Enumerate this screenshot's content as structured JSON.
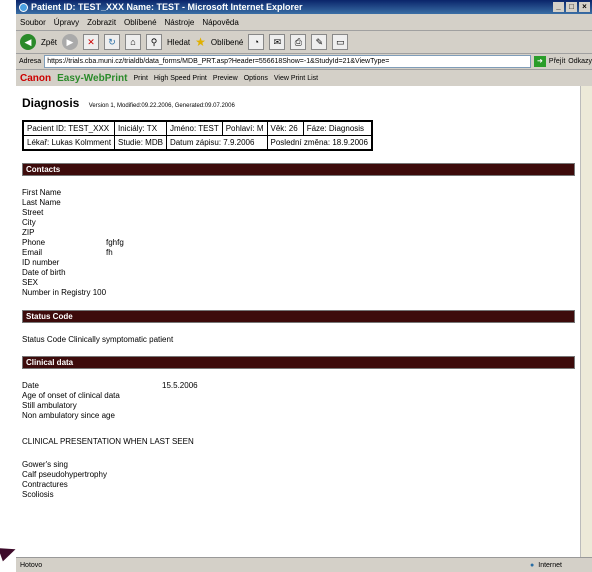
{
  "window": {
    "title": "Patient ID: TEST_XXX Name: TEST - Microsoft Internet Explorer"
  },
  "menu": [
    "Soubor",
    "Úpravy",
    "Zobrazit",
    "Oblíbené",
    "Nástroje",
    "Nápověda"
  ],
  "toolbar": {
    "back": "Zpět",
    "search": "Hledat",
    "favorites": "Oblíbené"
  },
  "address": {
    "label": "Adresa",
    "url": "https://trials.cba.muni.cz/trialdb/data_forms/MDB_PRT.asp?Header=556618Show=-1&StudyId=21&ViewType=",
    "go": "Přejít",
    "links": "Odkazy"
  },
  "canon": {
    "brand": "Canon",
    "product": "Easy-WebPrint",
    "print": "Print",
    "hsprint": "High Speed Print",
    "preview": "Preview",
    "options": "Options",
    "viewlist": "View Print List"
  },
  "diagnosis": {
    "title": "Diagnosis",
    "version": "Version 1, Modified:09.22.2006, Generated:09.07.2006"
  },
  "info": {
    "row1": [
      "Pacient ID: TEST_XXX",
      "Iniciály: TX",
      "Jméno: TEST",
      "Pohlaví: M",
      "Věk: 26",
      "Fáze: Diagnosis"
    ],
    "row2": [
      "Lékař: Lukas Kolmment",
      "Studie: MDB",
      "Datum zápisu: 7.9.2006",
      "Poslední změna: 18.9.2006"
    ]
  },
  "sections": {
    "contacts": "Contacts",
    "status": "Status Code",
    "clinical": "Clinical data"
  },
  "contacts": [
    {
      "label": "First Name",
      "value": ""
    },
    {
      "label": "Last Name",
      "value": ""
    },
    {
      "label": "Street",
      "value": ""
    },
    {
      "label": "City",
      "value": ""
    },
    {
      "label": "ZIP",
      "value": ""
    },
    {
      "label": "Phone",
      "value": "fghfg"
    },
    {
      "label": "Email",
      "value": "fh"
    },
    {
      "label": "ID number",
      "value": ""
    },
    {
      "label": "Date of birth",
      "value": ""
    },
    {
      "label": "SEX",
      "value": ""
    }
  ],
  "registry": "Number in Registry 100",
  "status_text": "Status Code Clinically symptomatic patient",
  "clinical": {
    "date_label": "Date",
    "date_value": "15.5.2006",
    "lines": [
      "Age of onset of clinical data",
      "Still ambulatory",
      "Non ambulatory since age"
    ],
    "presentation": "CLINICAL PRESENTATION WHEN LAST SEEN",
    "signs": [
      "Gower's sing",
      "Calf pseudohypertrophy",
      "Contractures",
      "Scoliosis"
    ]
  },
  "status": {
    "left": "Hotovo",
    "zone": "Internet"
  }
}
